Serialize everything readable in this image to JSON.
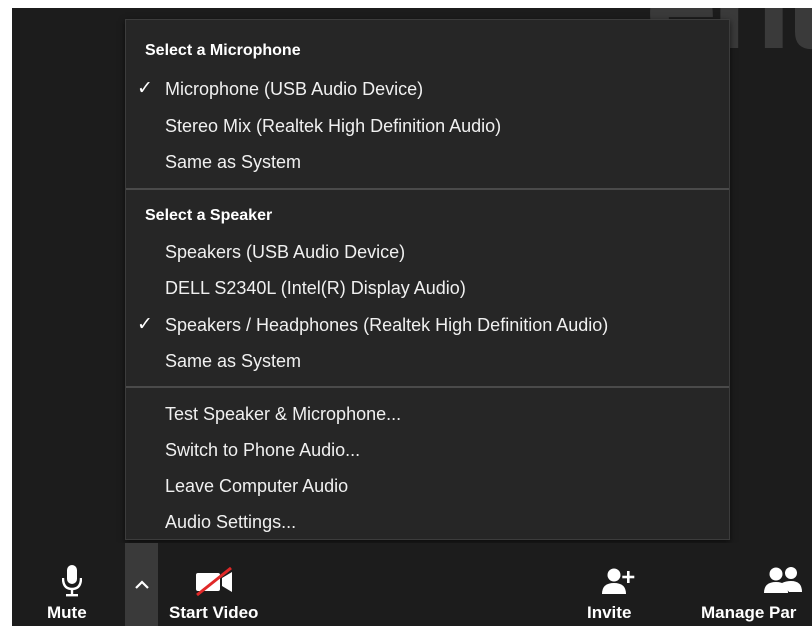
{
  "menu": {
    "microphone_header": "Select a Microphone",
    "microphones": [
      {
        "label": "Microphone (USB Audio Device)",
        "checked": true
      },
      {
        "label": "Stereo Mix (Realtek High Definition Audio)",
        "checked": false
      },
      {
        "label": "Same as System",
        "checked": false
      }
    ],
    "speaker_header": "Select a Speaker",
    "speakers": [
      {
        "label": "Speakers (USB Audio Device)",
        "checked": false
      },
      {
        "label": "DELL S2340L (Intel(R) Display Audio)",
        "checked": false
      },
      {
        "label": "Speakers / Headphones (Realtek High Definition Audio)",
        "checked": true
      },
      {
        "label": "Same as System",
        "checked": false
      }
    ],
    "actions": [
      {
        "label": "Test Speaker & Microphone..."
      },
      {
        "label": "Switch to Phone Audio..."
      },
      {
        "label": "Leave Computer Audio"
      },
      {
        "label": "Audio Settings..."
      }
    ],
    "check_glyph": "✓"
  },
  "toolbar": {
    "mute_label": "Mute",
    "start_video_label": "Start Video",
    "invite_label": "Invite",
    "manage_participants_label": "Manage Par"
  },
  "colors": {
    "app_background": "#1c1c1c",
    "menu_background": "#262626",
    "text": "#f0f0f0",
    "video_off_slash": "#e02828"
  }
}
